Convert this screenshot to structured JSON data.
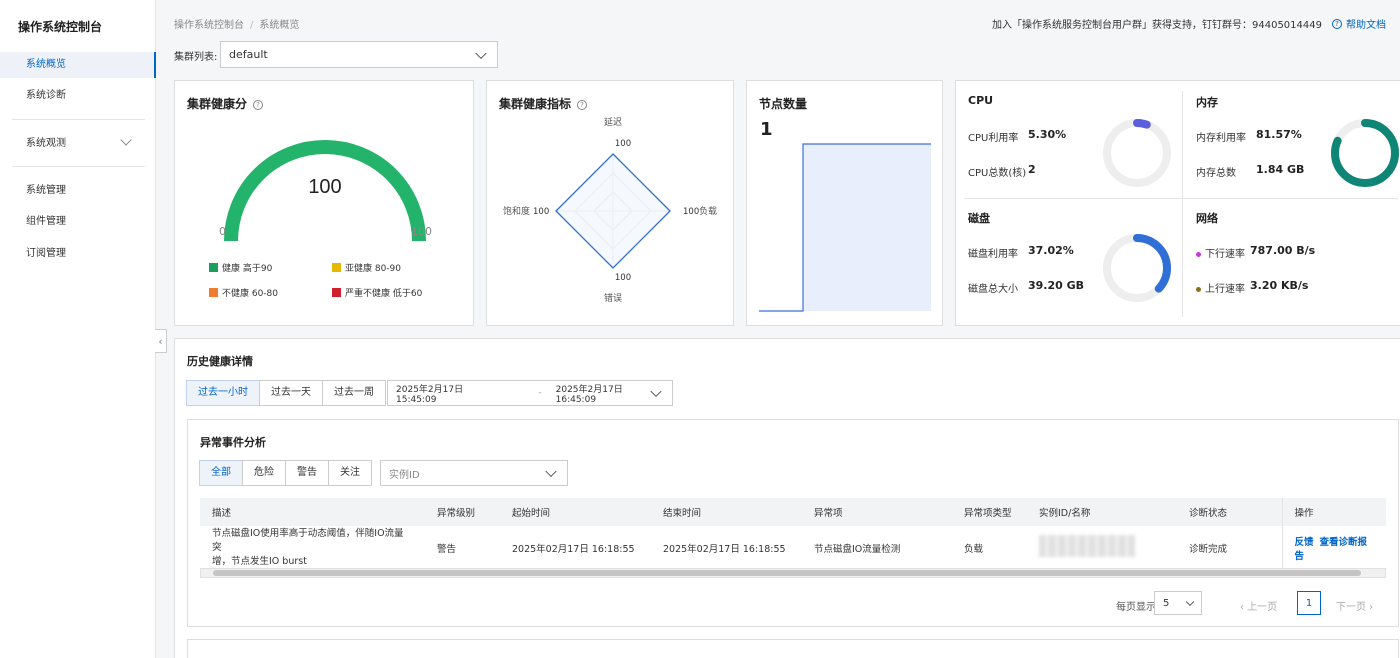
{
  "app": {
    "brand": "操作系统控制台"
  },
  "sidebar": {
    "items": [
      {
        "label": "系统概览"
      },
      {
        "label": "系统诊断"
      },
      {
        "label": "系统观测"
      },
      {
        "label": "系统管理"
      },
      {
        "label": "组件管理"
      },
      {
        "label": "订阅管理"
      }
    ],
    "collapse_glyph": "‹"
  },
  "breadcrumb": {
    "root": "操作系统控制台",
    "separator": "/",
    "current": "系统概览"
  },
  "header": {
    "join_text": "加入「操作系统服务控制台用户群」获得支持，钉钉群号：94405014449",
    "help_icon": "?",
    "help_label": "帮助文档"
  },
  "cluster": {
    "label": "集群列表:",
    "value": "default"
  },
  "health_score": {
    "title": "集群健康分",
    "help": "?",
    "score": "100",
    "min": "0",
    "max": "100",
    "fraction": 1.0,
    "gauge_color": "#23b36b",
    "legend": [
      {
        "label": "健康 高于90",
        "color": "#1a9e5c"
      },
      {
        "label": "亚健康 80-90",
        "color": "#e6b800"
      },
      {
        "label": "不健康 60-80",
        "color": "#f07d2e"
      },
      {
        "label": "严重不健康 低于60",
        "color": "#d0202e"
      }
    ]
  },
  "health_metrics": {
    "title": "集群健康指标",
    "help": "?",
    "axes": [
      {
        "name": "延迟",
        "value": "100"
      },
      {
        "name": "负载",
        "value": "100"
      },
      {
        "name": "错误",
        "value": "100"
      },
      {
        "name": "饱和度",
        "value": "100"
      }
    ]
  },
  "node_count": {
    "title": "节点数量",
    "value": "1",
    "fill_color": "#e8eefc",
    "line_color": "#3b6fd6"
  },
  "resources": {
    "cpu": {
      "title": "CPU",
      "usage_label": "CPU利用率",
      "usage_value": "5.30%",
      "usage_fraction": 0.053,
      "count_label": "CPU总数(核)",
      "count_value": "2",
      "ring_color": "#5b5fdb"
    },
    "memory": {
      "title": "内存",
      "usage_label": "内存利用率",
      "usage_value": "81.57%",
      "usage_fraction": 0.8157,
      "total_label": "内存总数",
      "total_value": "1.84 GB",
      "ring_color": "#0f8576"
    },
    "disk": {
      "title": "磁盘",
      "usage_label": "磁盘利用率",
      "usage_value": "37.02%",
      "usage_fraction": 0.3702,
      "total_label": "磁盘总大小",
      "total_value": "39.20 GB",
      "ring_color": "#2f6fd6"
    },
    "network": {
      "title": "网络",
      "down_label": "下行速率",
      "down_value": "787.00 B/s",
      "down_color": "#c23bd6",
      "up_label": "上行速率",
      "up_value": "3.20 KB/s",
      "up_color": "#8a6d1f"
    }
  },
  "history": {
    "title": "历史健康详情",
    "ranges": [
      "过去一小时",
      "过去一天",
      "过去一周"
    ],
    "active_range": 0,
    "start": "2025年2月17日 15:45:09",
    "dash": "-",
    "end": "2025年2月17日 16:45:09"
  },
  "events": {
    "title": "异常事件分析",
    "filters": [
      "全部",
      "危险",
      "警告",
      "关注"
    ],
    "active_filter": 0,
    "instance_placeholder": "实例ID",
    "columns": [
      "描述",
      "异常级别",
      "起始时间",
      "结束时间",
      "异常项",
      "异常项类型",
      "实例ID/名称",
      "诊断状态",
      "操作"
    ],
    "rows": [
      {
        "desc_line1": "节点磁盘IO使用率高于动态阈值，伴随IO流量突",
        "desc_line2": "增，节点发生IO burst",
        "level": "警告",
        "start": "2025年02月17日 16:18:55",
        "end": "2025年02月17日 16:18:55",
        "item": "节点磁盘IO流量检测",
        "item_type": "负载",
        "status": "诊断完成",
        "action_feedback": "反馈",
        "action_report": "查看诊断报告"
      }
    ],
    "pagination": {
      "per_page_label": "每页显示",
      "per_page": "5",
      "prev": "上一页",
      "current": "1",
      "next": "下一页"
    }
  }
}
